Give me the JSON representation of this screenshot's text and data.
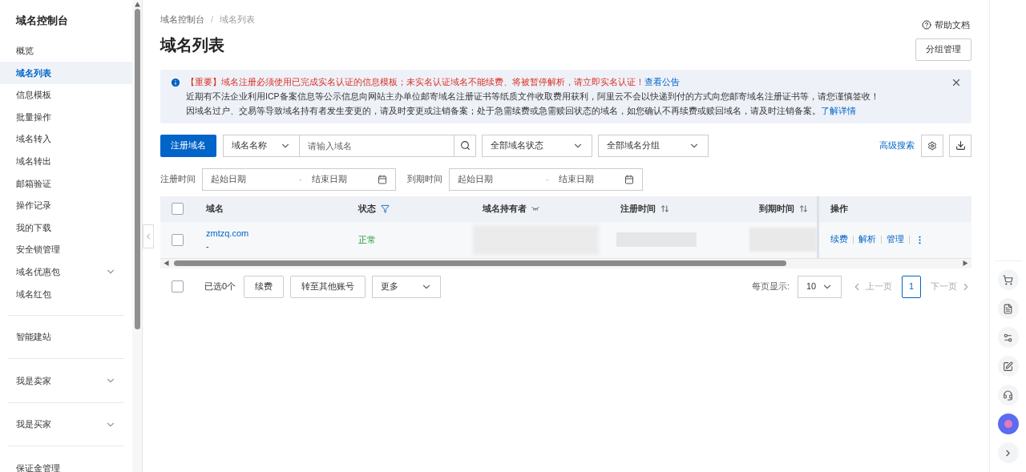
{
  "sidebar": {
    "title": "域名控制台",
    "groups": [
      {
        "items": [
          {
            "label": "概览",
            "selected": false,
            "expandable": false
          },
          {
            "label": "域名列表",
            "selected": true,
            "expandable": false
          },
          {
            "label": "信息模板",
            "selected": false,
            "expandable": false
          },
          {
            "label": "批量操作",
            "selected": false,
            "expandable": false
          },
          {
            "label": "域名转入",
            "selected": false,
            "expandable": false
          },
          {
            "label": "域名转出",
            "selected": false,
            "expandable": false
          },
          {
            "label": "邮箱验证",
            "selected": false,
            "expandable": false
          },
          {
            "label": "操作记录",
            "selected": false,
            "expandable": false
          },
          {
            "label": "我的下载",
            "selected": false,
            "expandable": false
          },
          {
            "label": "安全锁管理",
            "selected": false,
            "expandable": false
          },
          {
            "label": "域名优惠包",
            "selected": false,
            "expandable": true
          },
          {
            "label": "域名红包",
            "selected": false,
            "expandable": false
          }
        ]
      },
      {
        "items": [
          {
            "label": "智能建站",
            "selected": false,
            "expandable": false
          }
        ]
      },
      {
        "items": [
          {
            "label": "我是卖家",
            "selected": false,
            "expandable": true
          }
        ]
      },
      {
        "items": [
          {
            "label": "我是买家",
            "selected": false,
            "expandable": true
          }
        ]
      },
      {
        "items": [
          {
            "label": "保证金管理",
            "selected": false,
            "expandable": false
          }
        ]
      }
    ]
  },
  "breadcrumb": [
    "域名控制台",
    "域名列表"
  ],
  "breadcrumb_separator": "/",
  "page_title": "域名列表",
  "help_link": "帮助文档",
  "group_button": "分组管理",
  "notice": {
    "lines": [
      {
        "kind": "important",
        "text": "【重要】域名注册必须使用已完成实名认证的信息模板；未实名认证域名不能续费、将被暂停解析，请立即实名认证！",
        "link": "查看公告"
      },
      {
        "kind": "plain",
        "text": "近期有不法企业利用ICP备案信息等公示信息向网站主办单位邮寄域名注册证书等纸质文件收取费用获利，阿里云不会以快递到付的方式向您邮寄域名注册证书等，请您谨慎签收！"
      },
      {
        "kind": "plain",
        "text": "因域名过户、交易等导致域名持有者发生变更的，请及时变更或注销备案；处于急需续费或急需赎回状态的域名，如您确认不再续费或赎回域名，请及时注销备案。",
        "link": "了解详情"
      }
    ]
  },
  "toolbar": {
    "register_button": "注册域名",
    "search_type": "域名名称",
    "search_placeholder": "请输入域名",
    "status_filter": "全部域名状态",
    "group_filter": "全部域名分组",
    "advanced_search": "高级搜索"
  },
  "date_filters": [
    {
      "label": "注册时间",
      "start_placeholder": "起始日期",
      "separator": "-",
      "end_placeholder": "结束日期"
    },
    {
      "label": "到期时间",
      "start_placeholder": "起始日期",
      "separator": "-",
      "end_placeholder": "结束日期"
    }
  ],
  "table": {
    "select_all_checked": false,
    "columns": [
      "域名",
      "状态",
      "域名持有者",
      "注册时间",
      "到期时间",
      "操作"
    ],
    "rows": [
      {
        "checked": false,
        "domain": "zmtzq.com",
        "note": "-",
        "status": "正常",
        "actions": [
          "续费",
          "解析",
          "管理"
        ]
      }
    ]
  },
  "footer": {
    "select_all_checked": false,
    "selected_count": "已选0个",
    "buttons": [
      "续费",
      "转至其他账号"
    ],
    "more": "更多",
    "page_size_label": "每页显示:",
    "page_size": "10",
    "prev": "上一页",
    "pages": [
      {
        "label": "1",
        "selected": true
      }
    ],
    "next": "下一页"
  }
}
